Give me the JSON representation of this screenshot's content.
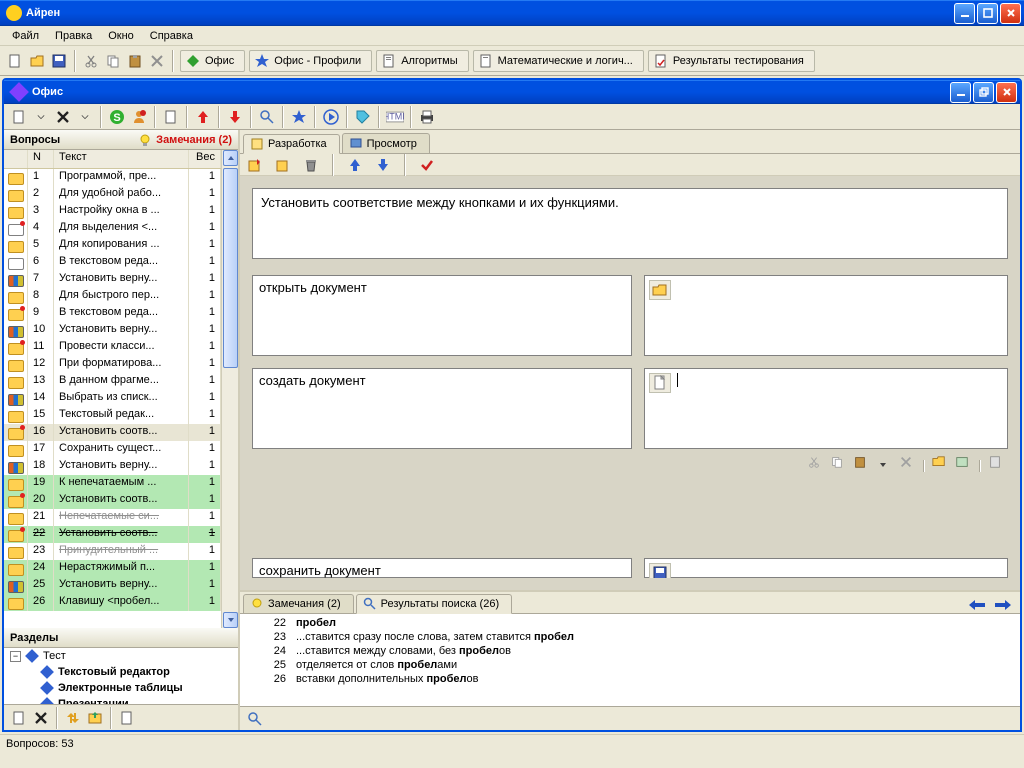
{
  "main_title": "Айрен",
  "menu": [
    "Файл",
    "Правка",
    "Окно",
    "Справка"
  ],
  "top_tabs": [
    {
      "label": "Офис"
    },
    {
      "label": "Офис - Профили"
    },
    {
      "label": "Алгоритмы"
    },
    {
      "label": "Математические и логич..."
    },
    {
      "label": "Результаты тестирования"
    }
  ],
  "inner_title": "Офис",
  "questions_header": "Вопросы",
  "notes_count": "Замечания (2)",
  "cols": {
    "n": "N",
    "text": "Текст",
    "w": "Вес"
  },
  "questions": [
    {
      "n": 1,
      "txt": "Программой, пре...",
      "w": 1,
      "ic": "folder"
    },
    {
      "n": 2,
      "txt": "Для удобной рабо...",
      "w": 1,
      "ic": "folder"
    },
    {
      "n": 3,
      "txt": "Настройку окна в ...",
      "w": 1,
      "ic": "folder"
    },
    {
      "n": 4,
      "txt": "Для выделения <...",
      "w": 1,
      "ic": "folder2 red"
    },
    {
      "n": 5,
      "txt": "Для копирования ...",
      "w": 1,
      "ic": "folder"
    },
    {
      "n": 6,
      "txt": "В текстовом реда...",
      "w": 1,
      "ic": "folder2"
    },
    {
      "n": 7,
      "txt": "Установить верну...",
      "w": 1,
      "ic": "bars"
    },
    {
      "n": 8,
      "txt": "Для быстрого пер...",
      "w": 1,
      "ic": "folder"
    },
    {
      "n": 9,
      "txt": "В текстовом реда...",
      "w": 1,
      "ic": "folder red"
    },
    {
      "n": 10,
      "txt": "Установить верну...",
      "w": 1,
      "ic": "bars"
    },
    {
      "n": 11,
      "txt": "Провести класси...",
      "w": 1,
      "ic": "folder red"
    },
    {
      "n": 12,
      "txt": "При форматирова...",
      "w": 1,
      "ic": "folder"
    },
    {
      "n": 13,
      "txt": "В данном фрагме...",
      "w": 1,
      "ic": "folder"
    },
    {
      "n": 14,
      "txt": "Выбрать из списк...",
      "w": 1,
      "ic": "bars"
    },
    {
      "n": 15,
      "txt": "Текстовый редак...",
      "w": 1,
      "ic": "folder"
    },
    {
      "n": 16,
      "txt": "Установить соотв...",
      "w": 1,
      "ic": "folder red",
      "sel": true
    },
    {
      "n": 17,
      "txt": "Сохранить сущест...",
      "w": 1,
      "ic": "folder"
    },
    {
      "n": 18,
      "txt": "Установить верну...",
      "w": 1,
      "ic": "bars"
    },
    {
      "n": 19,
      "txt": "К непечатаемым ...",
      "w": 1,
      "ic": "folder",
      "hl": true
    },
    {
      "n": 20,
      "txt": "Установить соотв...",
      "w": 1,
      "ic": "folder red",
      "hl": true
    },
    {
      "n": 21,
      "txt": "Непечатаемые си...",
      "w": 1,
      "ic": "folder",
      "struck": true
    },
    {
      "n": 22,
      "txt": "Установить соотв...",
      "w": 1,
      "ic": "folder red",
      "struckhl": true
    },
    {
      "n": 23,
      "txt": "Принудительный ...",
      "w": 1,
      "ic": "folder",
      "struck": true
    },
    {
      "n": 24,
      "txt": "Нерастяжимый п...",
      "w": 1,
      "ic": "folder",
      "hl": true
    },
    {
      "n": 25,
      "txt": "Установить верну...",
      "w": 1,
      "ic": "bars",
      "hl": true
    },
    {
      "n": 26,
      "txt": "Клавишу <пробел...",
      "w": 1,
      "ic": "folder",
      "hl": true
    }
  ],
  "sections_header": "Разделы",
  "tree": {
    "root": "Тест",
    "children": [
      "Текстовый редактор",
      "Электронные таблицы",
      "Презентации"
    ]
  },
  "tab_edit": "Разработка",
  "tab_view": "Просмотр",
  "question_text": "Установить соответствие между кнопками и их функциями.",
  "matches": [
    "открыть документ",
    "создать документ",
    "сохранить документ"
  ],
  "bottom_tab1": "Замечания (2)",
  "bottom_tab2": "Результаты поиска (26)",
  "notes": [
    {
      "n": 22,
      "txt_before": "",
      "bold": "пробел",
      "txt_after": ""
    },
    {
      "n": 23,
      "txt_before": "...ставится сразу после слова, затем ставится ",
      "bold": "пробел",
      "txt_after": ""
    },
    {
      "n": 24,
      "txt_before": "...ставится между словами, без ",
      "bold": "пробел",
      "txt_after": "ов"
    },
    {
      "n": 25,
      "txt_before": "отделяется от слов ",
      "bold": "пробел",
      "txt_after": "ами"
    },
    {
      "n": 26,
      "txt_before": "вставки дополнительных ",
      "bold": "пробел",
      "txt_after": "ов"
    }
  ],
  "status": "Вопросов: 53"
}
